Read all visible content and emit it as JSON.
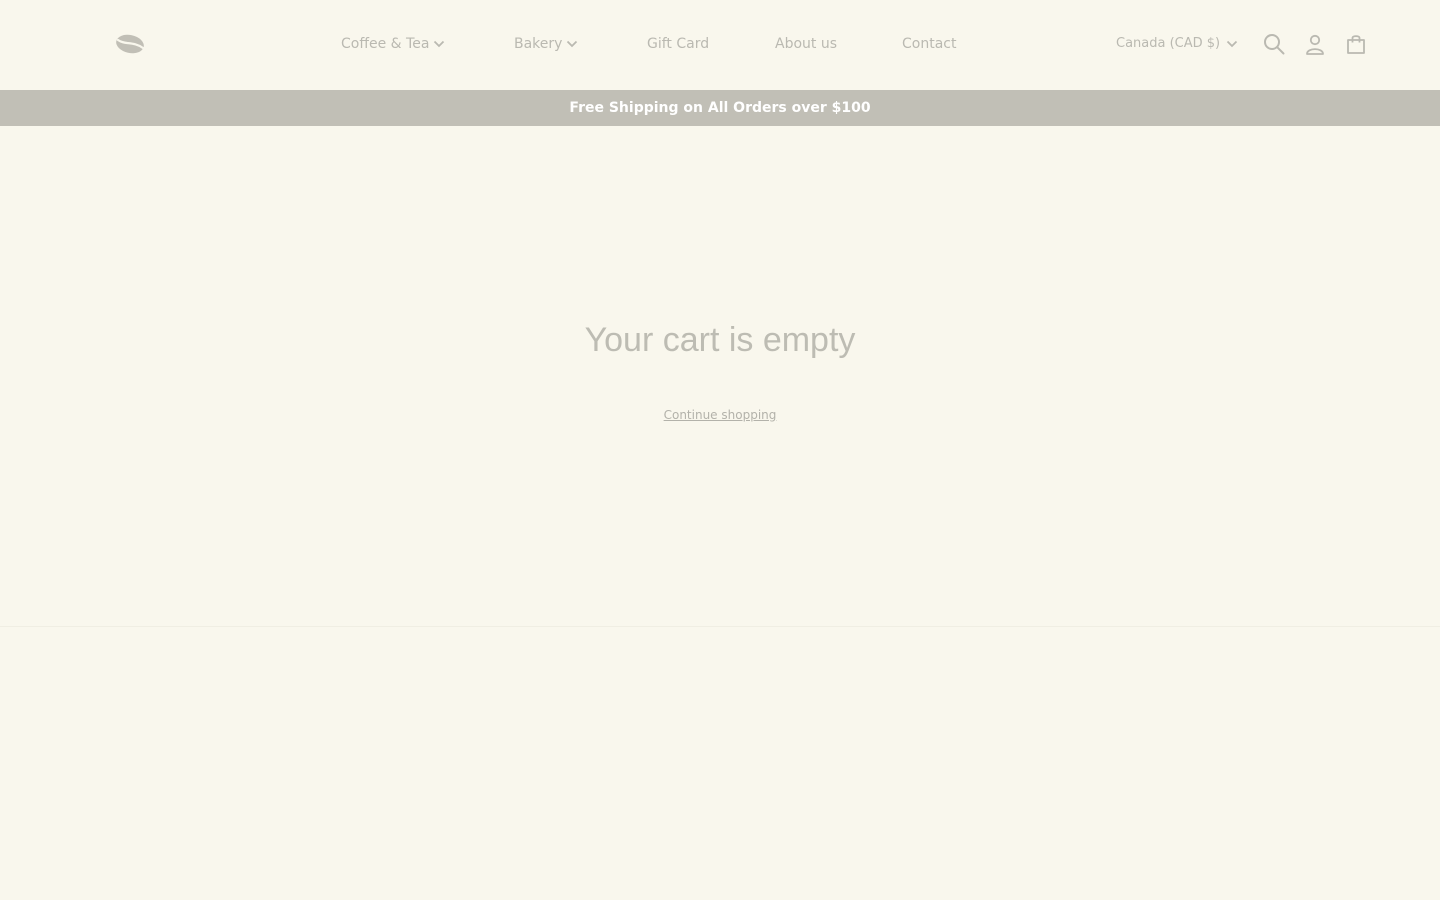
{
  "header": {
    "logo_icon": "coffee-bean-icon",
    "nav": [
      {
        "label": "Coffee & Tea",
        "has_dropdown": true
      },
      {
        "label": "Bakery",
        "has_dropdown": true
      },
      {
        "label": "Gift Card",
        "has_dropdown": false
      },
      {
        "label": "About us",
        "has_dropdown": false
      },
      {
        "label": "Contact",
        "has_dropdown": false
      }
    ],
    "country_selector": "Canada (CAD $)",
    "icons": [
      "search-icon",
      "account-icon",
      "cart-icon"
    ]
  },
  "announcement": {
    "text": "Free Shipping on All Orders over $100"
  },
  "main": {
    "title": "Your cart is empty",
    "continue_link": "Continue shopping"
  },
  "colors": {
    "background": "#f9f7ed",
    "announcement_bg": "#c1bfb6",
    "text_muted": "#bab9b1"
  }
}
